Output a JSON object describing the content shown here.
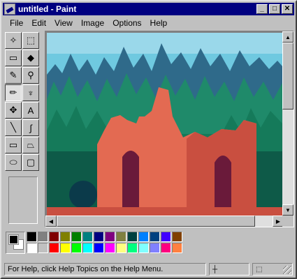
{
  "window": {
    "title": "untitled - Paint",
    "minimize_label": "_",
    "maximize_label": "□",
    "close_label": "✕"
  },
  "menu": [
    "File",
    "Edit",
    "View",
    "Image",
    "Options",
    "Help"
  ],
  "tools": [
    {
      "name": "free-form-select",
      "glyph": "✧"
    },
    {
      "name": "select",
      "glyph": "⬚"
    },
    {
      "name": "eraser",
      "glyph": "▭"
    },
    {
      "name": "fill-with-color",
      "glyph": "◆"
    },
    {
      "name": "pick-color",
      "glyph": "✎"
    },
    {
      "name": "magnifier",
      "glyph": "⚲"
    },
    {
      "name": "pencil",
      "glyph": "✏"
    },
    {
      "name": "brush",
      "glyph": "♆"
    },
    {
      "name": "airbrush",
      "glyph": "✥"
    },
    {
      "name": "text",
      "glyph": "A"
    },
    {
      "name": "line",
      "glyph": "╲"
    },
    {
      "name": "curve",
      "glyph": "∫"
    },
    {
      "name": "rectangle",
      "glyph": "▭"
    },
    {
      "name": "polygon",
      "glyph": "⏢"
    },
    {
      "name": "ellipse",
      "glyph": "⬭"
    },
    {
      "name": "rounded-rectangle",
      "glyph": "▢"
    }
  ],
  "active_tool": "pencil",
  "palette": {
    "foreground": "#000000",
    "background": "#ffffff",
    "colors": [
      "#000000",
      "#808080",
      "#800000",
      "#808000",
      "#008000",
      "#008080",
      "#000080",
      "#800080",
      "#808040",
      "#004040",
      "#0080ff",
      "#004080",
      "#4000ff",
      "#804000",
      "#ffffff",
      "#c0c0c0",
      "#ff0000",
      "#ffff00",
      "#00ff00",
      "#00ffff",
      "#0000ff",
      "#ff00ff",
      "#ffff80",
      "#00ff80",
      "#80ffff",
      "#8080ff",
      "#ff0080",
      "#ff8040"
    ]
  },
  "status": {
    "help_text": "For Help, click Help Topics on the Help Menu."
  }
}
